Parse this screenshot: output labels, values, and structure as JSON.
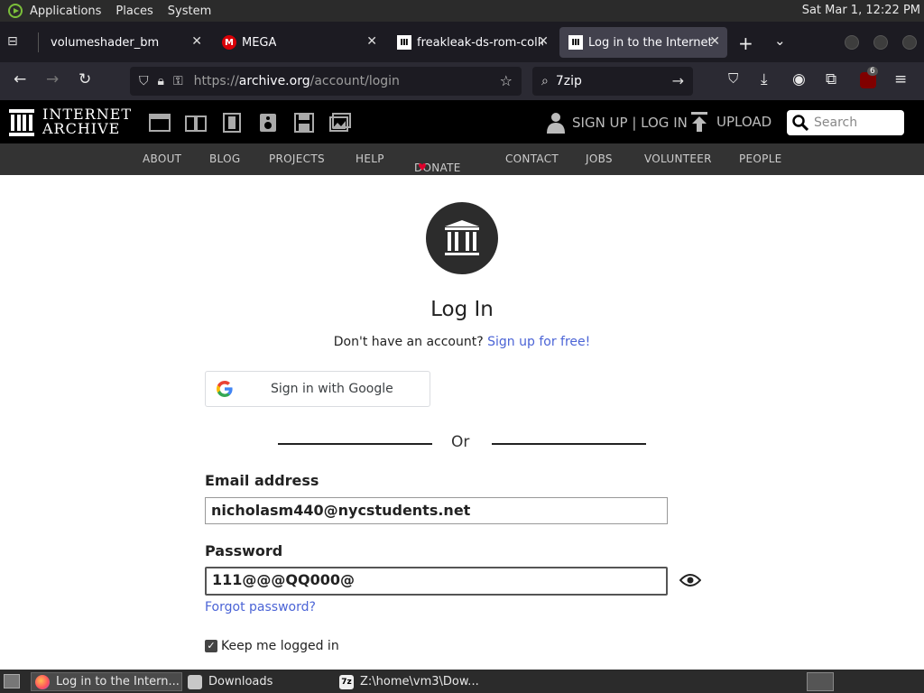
{
  "system_panel": {
    "menus": [
      "Applications",
      "Places",
      "System"
    ],
    "clock": "Sat Mar  1, 12:22 PM"
  },
  "tabs": [
    {
      "title": "volumeshader_bm",
      "active": false
    },
    {
      "title": "MEGA",
      "active": false
    },
    {
      "title": "freakleak-ds-rom-colle",
      "active": false
    },
    {
      "title": "Log in to the Internet A",
      "active": true
    }
  ],
  "navbar": {
    "url_base": "https://",
    "url_domain": "archive.org",
    "url_path": "/account/login",
    "search_value": "7zip",
    "ublock_count": "6"
  },
  "ia_header": {
    "logo_line1": "INTERNET",
    "logo_line2": "ARCHIVE",
    "account_text": "SIGN UP | LOG IN",
    "upload_text": "UPLOAD",
    "search_placeholder": "Search"
  },
  "ia_nav": [
    "ABOUT",
    "BLOG",
    "PROJECTS",
    "HELP",
    "DONATE",
    "CONTACT",
    "JOBS",
    "VOLUNTEER",
    "PEOPLE"
  ],
  "login": {
    "title": "Log In",
    "no_account_text": "Don't have an account?",
    "signup_link": "Sign up for free!",
    "google_button": "Sign in with Google",
    "or_text": "Or",
    "email_label": "Email address",
    "email_value": "nicholasm440@nycstudents.net",
    "password_label": "Password",
    "password_value": "111@@@QQ000@",
    "forgot_link": "Forgot password?",
    "keep_logged_in": "Keep me logged in",
    "keep_logged_in_checked": true
  },
  "taskbar": [
    {
      "label": "Log in to the Intern...",
      "active": true
    },
    {
      "label": "Downloads",
      "active": false
    },
    {
      "label": "Z:\\home\\vm3\\Dow...",
      "active": false
    }
  ],
  "colors": {
    "link": "#4b64d6",
    "ia_black": "#000000",
    "ia_nav": "#333333",
    "donate_heart": "#e0002c"
  }
}
